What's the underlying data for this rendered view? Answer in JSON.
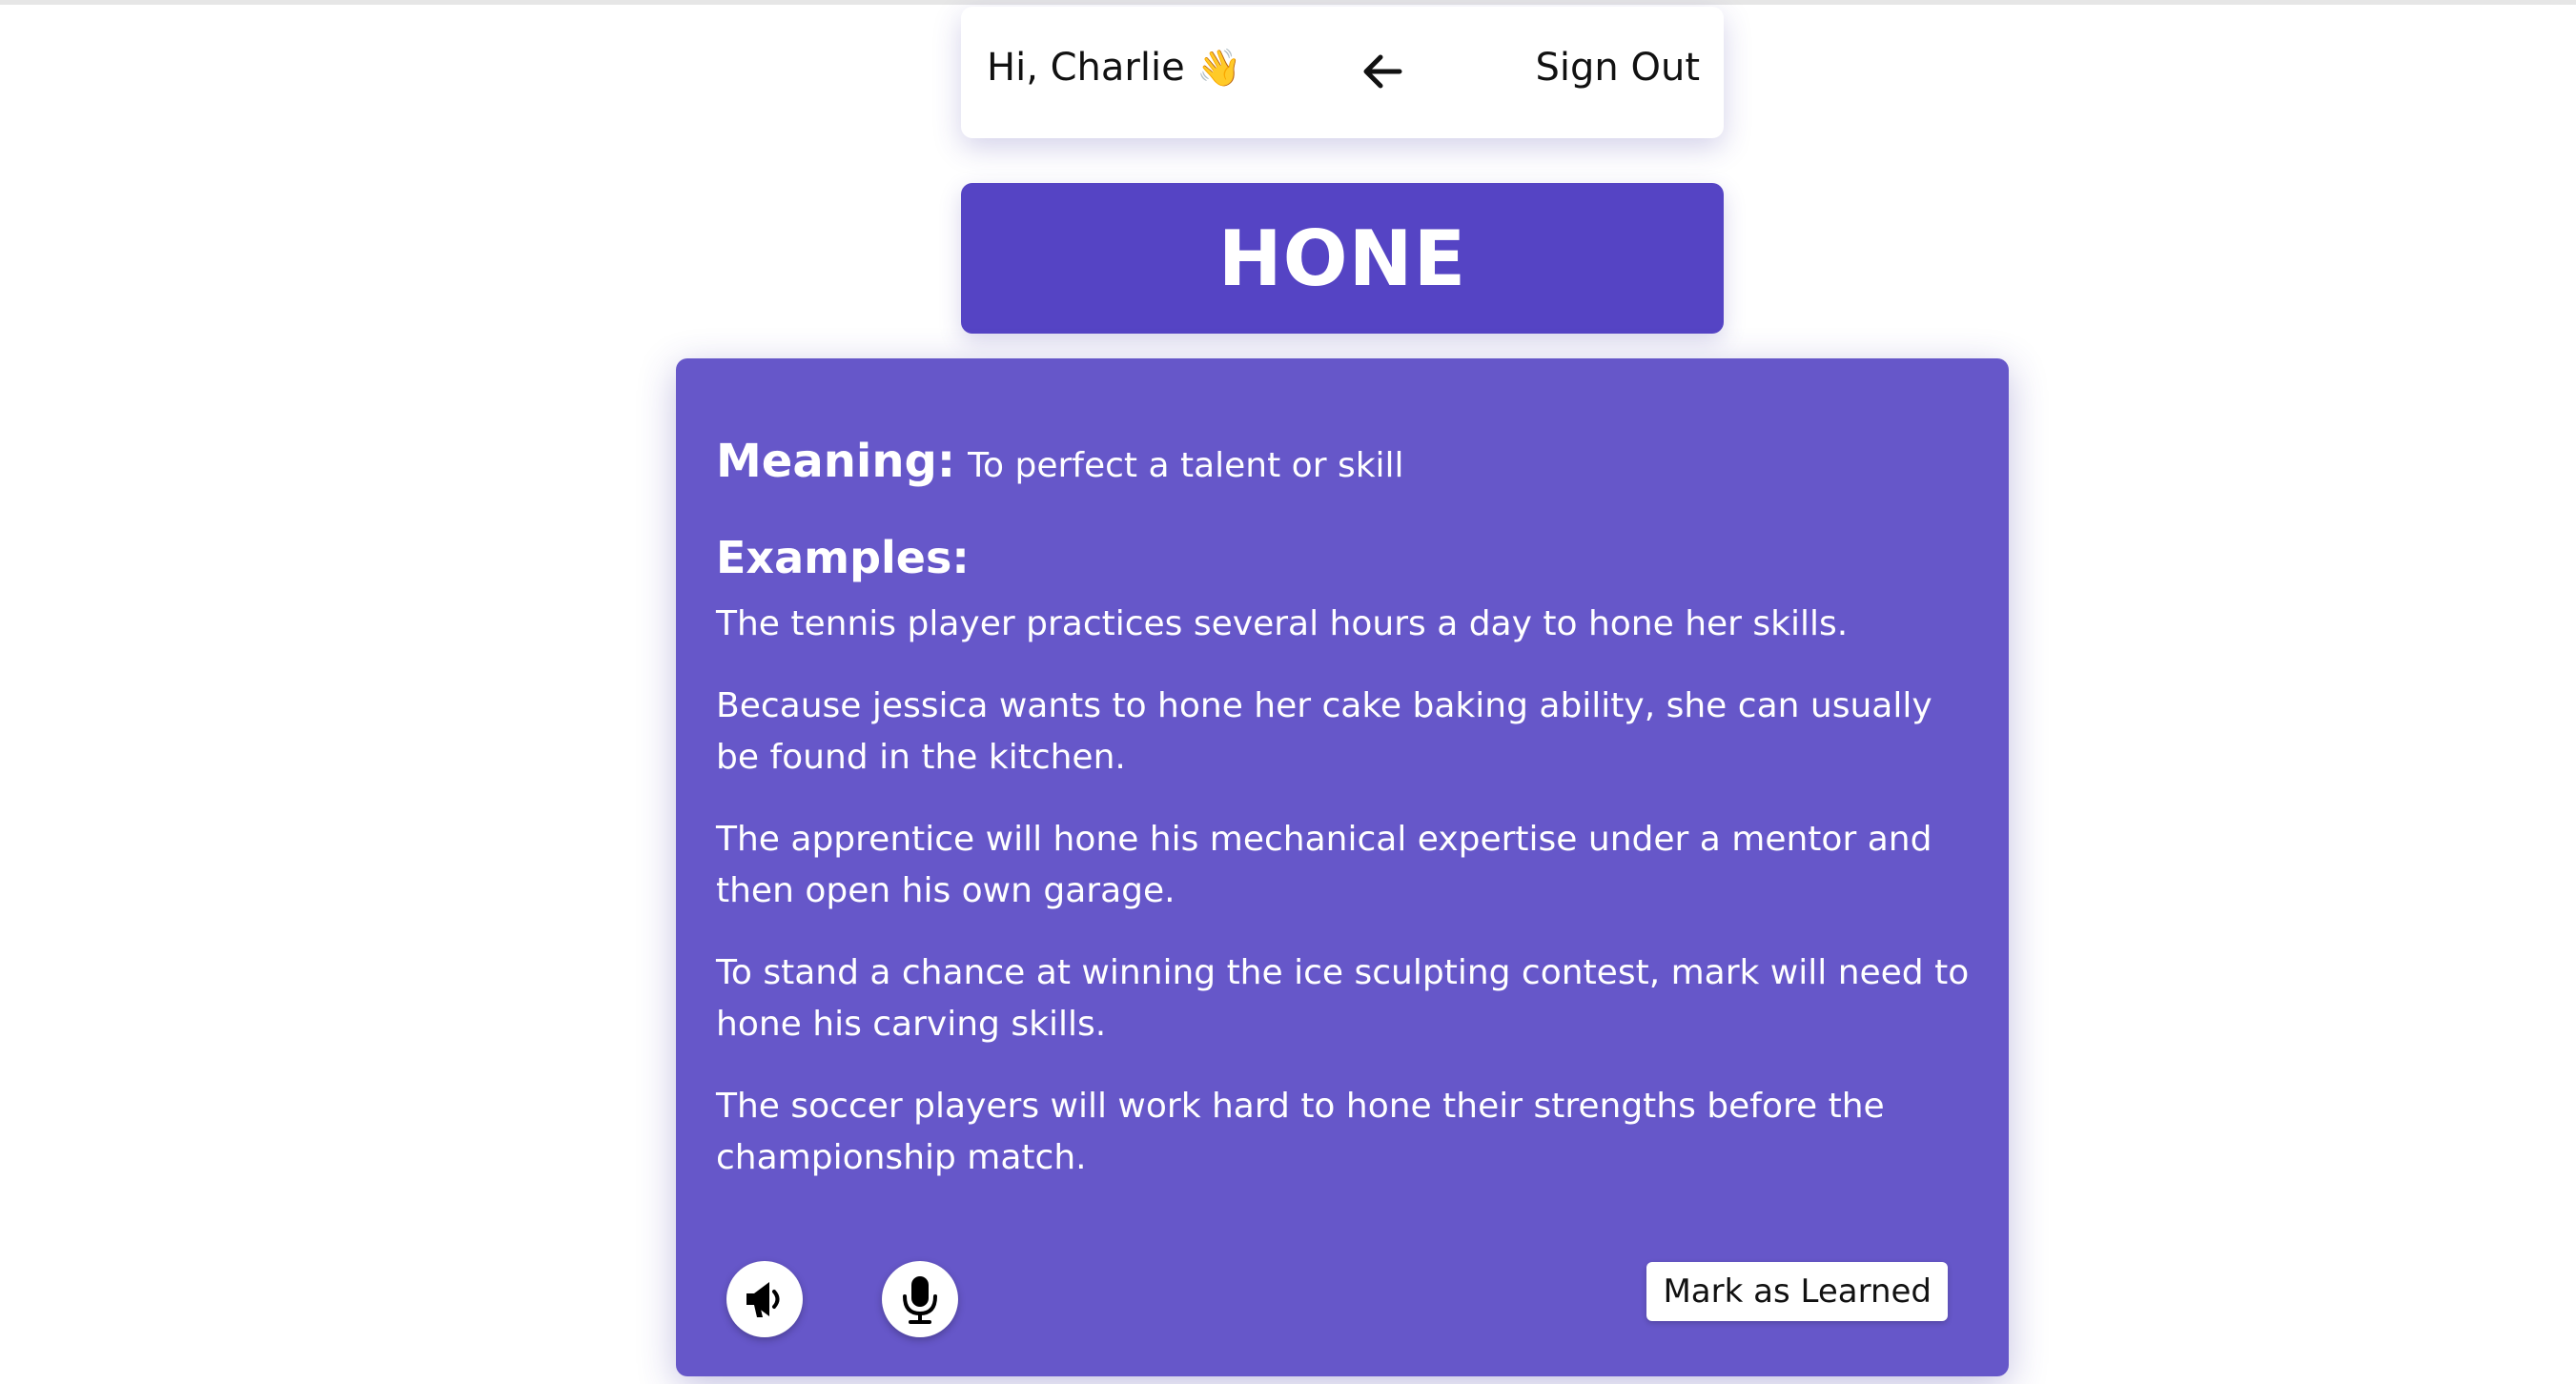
{
  "header": {
    "greeting": "Hi, Charlie",
    "wave_emoji": "👋",
    "back_icon": "arrow-left-icon",
    "sign_out_label": "Sign Out"
  },
  "word": {
    "title": "HONE"
  },
  "card": {
    "meaning_label": "Meaning:",
    "meaning_text": "To perfect a talent or skill",
    "examples_label": "Examples:",
    "examples": [
      "The tennis player practices several hours a day to hone her skills.",
      "Because jessica wants to hone her cake baking ability, she can usually be found in the kitchen.",
      "The apprentice will hone his mechanical expertise under a mentor and then open his own garage.",
      "To stand a chance at winning the ice sculpting contest, mark will need to hone his carving skills.",
      "The soccer players will work hard to hone their strengths before the championship match."
    ],
    "speak_icon": "speaker-icon",
    "mic_icon": "microphone-icon",
    "mark_learned_label": "Mark as Learned"
  },
  "colors": {
    "banner": "#5544c4",
    "card": "#6657c9",
    "text_on_purple": "#ffffff"
  }
}
